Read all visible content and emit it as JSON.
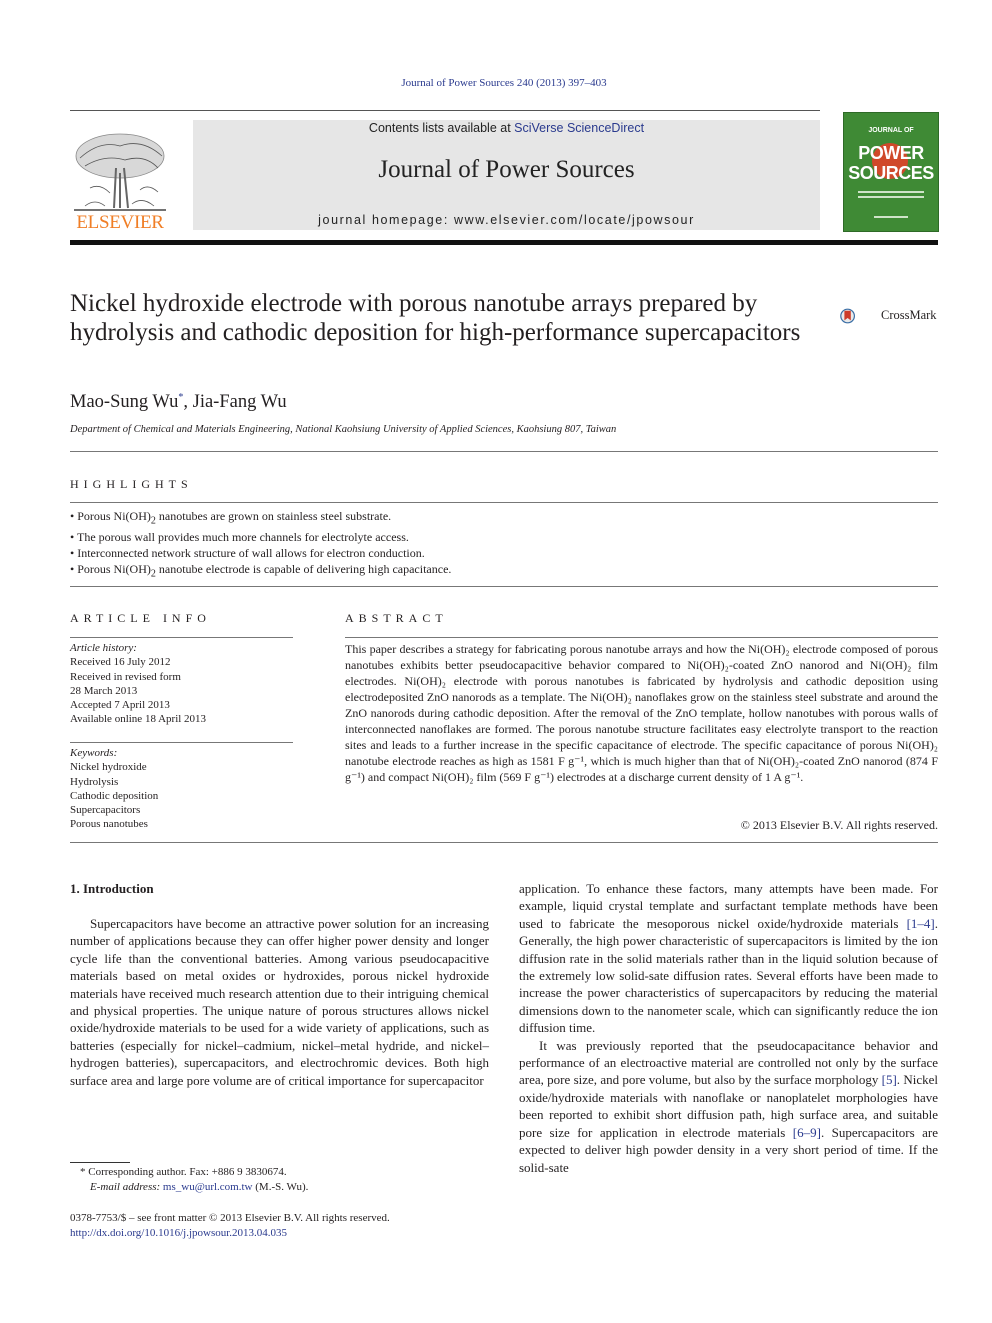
{
  "header": {
    "journal_ref": "Journal of Power Sources 240 (2013) 397–403",
    "contents_prefix": "Contents lists available at ",
    "contents_link": "SciVerse ScienceDirect",
    "journal_name": "Journal of Power Sources",
    "homepage_label": "journal homepage: www.elsevier.com/locate/jpowsour",
    "publisher_logo_text": "ELSEVIER",
    "cover": {
      "line1": "JOURNAL OF",
      "line2": "POWER",
      "line3": "SOURCES",
      "bg_color": "#3f8a35"
    },
    "crossmark_label": "CrossMark"
  },
  "article": {
    "title": "Nickel hydroxide electrode with porous nanotube arrays prepared by hydrolysis and cathodic deposition for high-performance supercapacitors",
    "authors": [
      {
        "name": "Mao-Sung Wu",
        "mark": "*"
      },
      {
        "name": "Jia-Fang Wu",
        "mark": ""
      }
    ],
    "author_separator": ", ",
    "affiliation": "Department of Chemical and Materials Engineering, National Kaohsiung University of Applied Sciences, Kaohsiung 807, Taiwan"
  },
  "highlights": {
    "heading": "HIGHLIGHTS",
    "items": [
      {
        "pre": "Porous Ni(OH)",
        "sub": "2",
        "post": " nanotubes are grown on stainless steel substrate."
      },
      {
        "pre": "The porous wall provides much more channels for electrolyte access.",
        "sub": "",
        "post": ""
      },
      {
        "pre": "Interconnected network structure of wall allows for electron conduction.",
        "sub": "",
        "post": ""
      },
      {
        "pre": "Porous Ni(OH)",
        "sub": "2",
        "post": " nanotube electrode is capable of delivering high capacitance."
      }
    ]
  },
  "article_info": {
    "heading": "ARTICLE INFO",
    "history_label": "Article history:",
    "history": [
      "Received 16 July 2012",
      "Received in revised form",
      "28 March 2013",
      "Accepted 7 April 2013",
      "Available online 18 April 2013"
    ],
    "keywords_label": "Keywords:",
    "keywords": [
      "Nickel hydroxide",
      "Hydrolysis",
      "Cathodic deposition",
      "Supercapacitors",
      "Porous nanotubes"
    ]
  },
  "abstract": {
    "heading": "ABSTRACT",
    "text": "This paper describes a strategy for fabricating porous nanotube arrays and how the Ni(OH)₂ electrode composed of porous nanotubes exhibits better pseudocapacitive behavior compared to Ni(OH)₂-coated ZnO nanorod and Ni(OH)₂ film electrodes. Ni(OH)₂ electrode with porous nanotubes is fabricated by hydrolysis and cathodic deposition using electrodeposited ZnO nanorods as a template. The Ni(OH)₂ nanoflakes grow on the stainless steel substrate and around the ZnO nanorods during cathodic deposition. After the removal of the ZnO template, hollow nanotubes with porous walls of interconnected nanoflakes are formed. The porous nanotube structure facilitates easy electrolyte transport to the reaction sites and leads to a further increase in the specific capacitance of electrode. The specific capacitance of porous Ni(OH)₂ nanotube electrode reaches as high as 1581 F g⁻¹, which is much higher than that of Ni(OH)₂-coated ZnO nanorod (874 F g⁻¹) and compact Ni(OH)₂ film (569 F g⁻¹) electrodes at a discharge current density of 1 A g⁻¹.",
    "copyright": "© 2013 Elsevier B.V. All rights reserved."
  },
  "introduction": {
    "heading": "1.  Introduction",
    "left_para": "Supercapacitors have become an attractive power solution for an increasing number of applications because they can offer higher power density and longer cycle life than the conventional batteries. Among various pseudocapacitive materials based on metal oxides or hydroxides, porous nickel hydroxide materials have received much research attention due to their intriguing chemical and physical properties. The unique nature of porous structures allows nickel oxide/hydroxide materials to be used for a wide variety of applications, such as batteries (especially for nickel–cadmium, nickel–metal hydride, and nickel–hydrogen batteries), supercapacitors, and electrochromic devices. Both high surface area and large pore volume are of critical importance for supercapacitor",
    "right_para1_a": "application. To enhance these factors, many attempts have been made. For example, liquid crystal template and surfactant template methods have been used to fabricate the mesoporous nickel oxide/hydroxide materials ",
    "ref_1_4": "[1–4]",
    "right_para1_b": ". Generally, the high power characteristic of supercapacitors is limited by the ion diffusion rate in the solid materials rather than in the liquid solution because of the extremely low solid-sate diffusion rates. Several efforts have been made to increase the power characteristics of supercapacitors by reducing the material dimensions down to the nanometer scale, which can significantly reduce the ion diffusion time.",
    "right_para2_a": "It was previously reported that the pseudocapacitance behavior and performance of an electroactive material are controlled not only by the surface area, pore size, and pore volume, but also by the surface morphology ",
    "ref_5": "[5]",
    "right_para2_b": ". Nickel oxide/hydroxide materials with nanoflake or nanoplatelet morphologies have been reported to exhibit short diffusion path, high surface area, and suitable pore size for application in electrode materials ",
    "ref_6_9": "[6–9]",
    "right_para2_c": ". Supercapacitors are expected to deliver high powder density in a very short period of time. If the solid-sate"
  },
  "footnote": {
    "mark": "*",
    "corresponding": " Corresponding author. Fax: +886 9 3830674.",
    "email_label": "E-mail address: ",
    "email": "ms_wu@url.com.tw",
    "email_suffix": " (M.-S. Wu)."
  },
  "front_matter": {
    "issn_line": "0378-7753/$ – see front matter © 2013 Elsevier B.V. All rights reserved.",
    "doi": "http://dx.doi.org/10.1016/j.jpowsour.2013.04.035"
  }
}
